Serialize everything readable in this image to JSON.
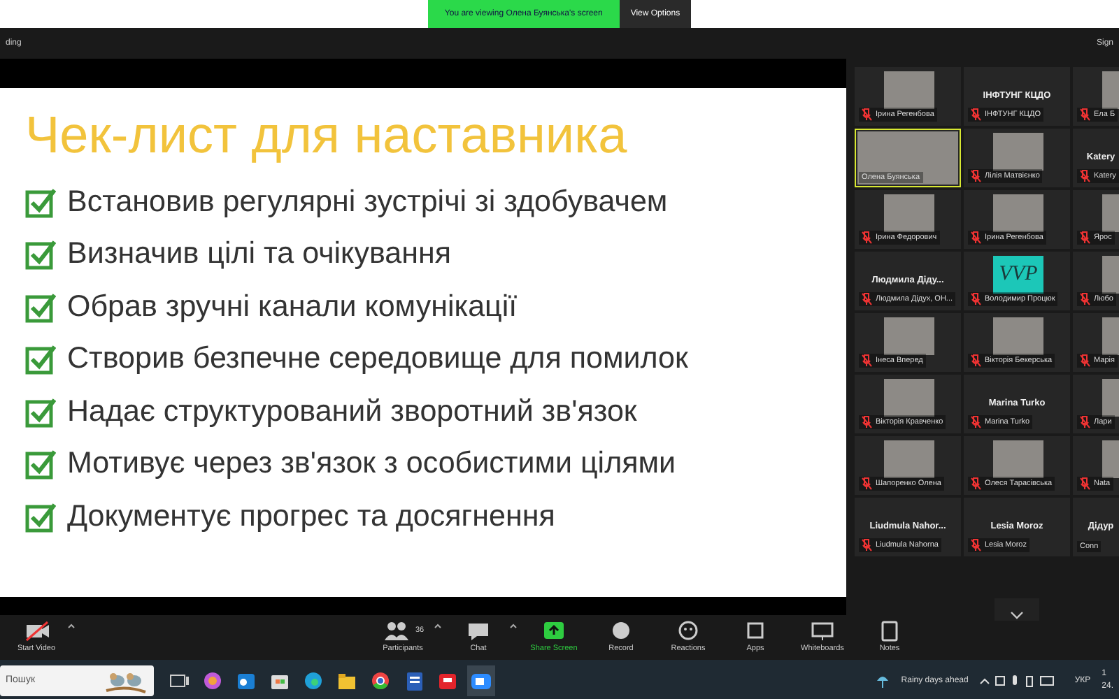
{
  "title_bar": {
    "banner": "You are viewing Олена Буянська's screen",
    "view_options": "View Options"
  },
  "header": {
    "left": "ding",
    "right": "Sign"
  },
  "slide": {
    "title": "Чек-лист для наставника",
    "items": [
      {
        "text": "Встановив регулярні зустрічі зі здобувачем",
        "checked": true
      },
      {
        "text": "Визначив цілі та очікування",
        "checked": true
      },
      {
        "text": "Обрав зручні канали комунікації",
        "checked": true
      },
      {
        "text": "Створив безпечне середовище для помилок",
        "checked": true
      },
      {
        "text": "Надає структурований зворотний зв'язок",
        "checked": true
      },
      {
        "text": "Мотивує через зв'язок з особистими цілями",
        "checked": true
      },
      {
        "text": "Документує прогрес та досягнення",
        "checked": true
      }
    ]
  },
  "gallery": {
    "tiles": [
      {
        "kind": "photo",
        "name": "Ірина Регенбова",
        "muted": true,
        "selected": false
      },
      {
        "kind": "text",
        "center": "ІНФТУНГ КЦДО",
        "name": "ІНФТУНГ КЦДО",
        "muted": true,
        "selected": false
      },
      {
        "kind": "photo",
        "name": "Ела Б",
        "muted": true,
        "selected": false
      },
      {
        "kind": "photo",
        "name": "Олена Буянська",
        "muted": false,
        "selected": true
      },
      {
        "kind": "photo",
        "name": "Лілія Матвієнко",
        "muted": true,
        "selected": false
      },
      {
        "kind": "text",
        "center": "Katery",
        "name": "Katery",
        "muted": true,
        "selected": false
      },
      {
        "kind": "photo",
        "name": "Ірина Федорович",
        "muted": true,
        "selected": false
      },
      {
        "kind": "photo",
        "name": "Ірина Регенбова",
        "muted": true,
        "selected": false
      },
      {
        "kind": "photo",
        "name": "Ярос",
        "muted": true,
        "selected": false
      },
      {
        "kind": "text",
        "center": "Людмила Діду...",
        "name": "Людмила Дідух, ОН...",
        "muted": true,
        "selected": false
      },
      {
        "kind": "avatar",
        "center": "VVP",
        "name": "Володимир Процюк",
        "muted": true,
        "selected": false
      },
      {
        "kind": "photo",
        "name": "Любо",
        "muted": true,
        "selected": false
      },
      {
        "kind": "photo",
        "name": "Інеса Вперед",
        "muted": true,
        "selected": false
      },
      {
        "kind": "photo",
        "name": "Вікторія Бекерська",
        "muted": true,
        "selected": false
      },
      {
        "kind": "photo",
        "name": "Марія",
        "muted": true,
        "selected": false
      },
      {
        "kind": "photo",
        "name": "Вікторія Кравченко",
        "muted": true,
        "selected": false
      },
      {
        "kind": "text",
        "center": "Marina Turko",
        "name": "Marina Turko",
        "muted": true,
        "selected": false
      },
      {
        "kind": "photo",
        "name": "Лари",
        "muted": true,
        "selected": false
      },
      {
        "kind": "photo",
        "name": "Шапоренко Олена",
        "muted": true,
        "selected": false
      },
      {
        "kind": "photo",
        "name": "Олеся Тарасівська",
        "muted": true,
        "selected": false
      },
      {
        "kind": "photo",
        "name": "Nata",
        "muted": true,
        "selected": false
      },
      {
        "kind": "text",
        "center": "Liudmula Nahor...",
        "name": "Liudmula Nahorna",
        "muted": true,
        "selected": false
      },
      {
        "kind": "text",
        "center": "Lesia Moroz",
        "name": "Lesia Moroz",
        "muted": true,
        "selected": false
      },
      {
        "kind": "text",
        "center": "Дідур",
        "name": "Conn",
        "muted": false,
        "selected": false
      }
    ]
  },
  "toolbar": {
    "left": [
      {
        "kind": "video",
        "label": "Start Video"
      }
    ],
    "center": [
      {
        "kind": "participants",
        "label": "Participants",
        "count": "36"
      },
      {
        "kind": "chat",
        "label": "Chat"
      },
      {
        "kind": "share",
        "label": "Share Screen"
      },
      {
        "kind": "record",
        "label": "Record"
      },
      {
        "kind": "reactions",
        "label": "Reactions"
      },
      {
        "kind": "apps",
        "label": "Apps"
      },
      {
        "kind": "whiteboards",
        "label": "Whiteboards"
      },
      {
        "kind": "notes",
        "label": "Notes"
      }
    ]
  },
  "taskbar": {
    "search_placeholder": "Пошук",
    "apps": [
      {
        "kind": "taskview",
        "active": false
      },
      {
        "kind": "copilot",
        "active": false
      },
      {
        "kind": "outlook",
        "active": false
      },
      {
        "kind": "store",
        "active": false
      },
      {
        "kind": "edge",
        "active": false
      },
      {
        "kind": "files",
        "active": false
      },
      {
        "kind": "chrome",
        "active": false
      },
      {
        "kind": "word",
        "active": false
      },
      {
        "kind": "redapp",
        "active": false
      },
      {
        "kind": "zoom",
        "active": true
      }
    ],
    "weather": "Rainy days ahead",
    "language": "УКР",
    "clock": [
      "1",
      "24."
    ]
  }
}
